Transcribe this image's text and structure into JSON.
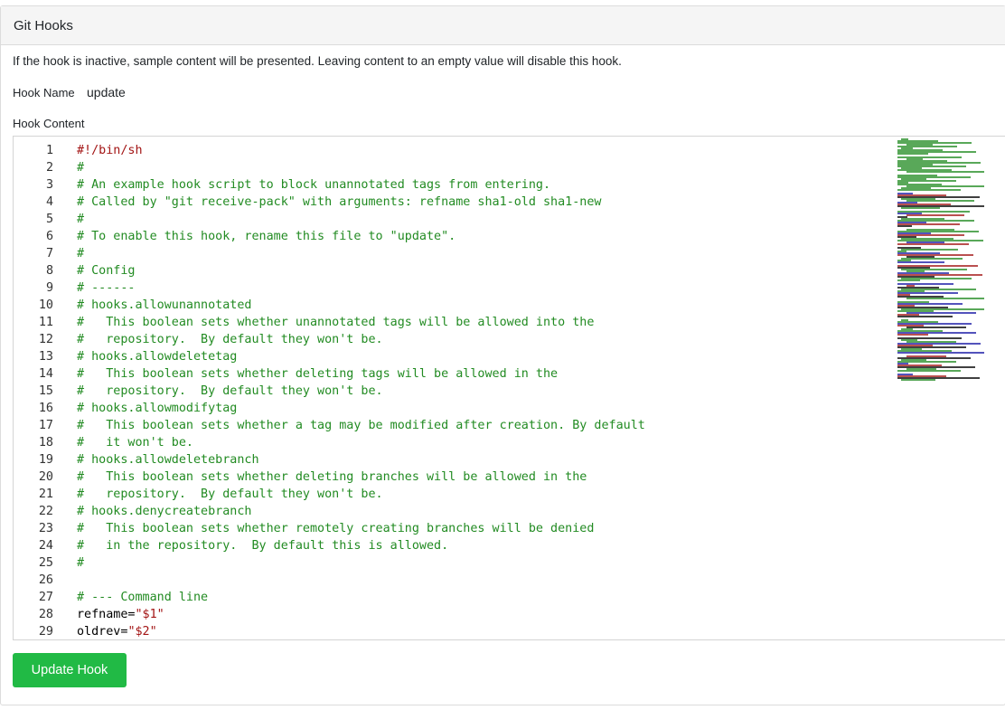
{
  "header": {
    "title": "Git Hooks"
  },
  "description": "If the hook is inactive, sample content will be presented. Leaving content to an empty value will disable this hook.",
  "hook": {
    "name_label": "Hook Name",
    "name_value": "update",
    "content_label": "Hook Content"
  },
  "editor": {
    "lines": [
      {
        "n": "1",
        "t": "#!/bin/sh",
        "k": "shebang"
      },
      {
        "n": "2",
        "t": "#",
        "k": "comment"
      },
      {
        "n": "3",
        "t": "# An example hook script to block unannotated tags from entering.",
        "k": "comment"
      },
      {
        "n": "4",
        "t": "# Called by \"git receive-pack\" with arguments: refname sha1-old sha1-new",
        "k": "comment"
      },
      {
        "n": "5",
        "t": "#",
        "k": "comment"
      },
      {
        "n": "6",
        "t": "# To enable this hook, rename this file to \"update\".",
        "k": "comment"
      },
      {
        "n": "7",
        "t": "#",
        "k": "comment"
      },
      {
        "n": "8",
        "t": "# Config",
        "k": "comment"
      },
      {
        "n": "9",
        "t": "# ------",
        "k": "comment"
      },
      {
        "n": "10",
        "t": "# hooks.allowunannotated",
        "k": "comment"
      },
      {
        "n": "11",
        "t": "#   This boolean sets whether unannotated tags will be allowed into the",
        "k": "comment"
      },
      {
        "n": "12",
        "t": "#   repository.  By default they won't be.",
        "k": "comment"
      },
      {
        "n": "13",
        "t": "# hooks.allowdeletetag",
        "k": "comment"
      },
      {
        "n": "14",
        "t": "#   This boolean sets whether deleting tags will be allowed in the",
        "k": "comment"
      },
      {
        "n": "15",
        "t": "#   repository.  By default they won't be.",
        "k": "comment"
      },
      {
        "n": "16",
        "t": "# hooks.allowmodifytag",
        "k": "comment"
      },
      {
        "n": "17",
        "t": "#   This boolean sets whether a tag may be modified after creation. By default",
        "k": "comment"
      },
      {
        "n": "18",
        "t": "#   it won't be.",
        "k": "comment"
      },
      {
        "n": "19",
        "t": "# hooks.allowdeletebranch",
        "k": "comment"
      },
      {
        "n": "20",
        "t": "#   This boolean sets whether deleting branches will be allowed in the",
        "k": "comment"
      },
      {
        "n": "21",
        "t": "#   repository.  By default they won't be.",
        "k": "comment"
      },
      {
        "n": "22",
        "t": "# hooks.denycreatebranch",
        "k": "comment"
      },
      {
        "n": "23",
        "t": "#   This boolean sets whether remotely creating branches will be denied",
        "k": "comment"
      },
      {
        "n": "24",
        "t": "#   in the repository.  By default this is allowed.",
        "k": "comment"
      },
      {
        "n": "25",
        "t": "#",
        "k": "comment"
      },
      {
        "n": "26",
        "t": "",
        "k": "plain"
      },
      {
        "n": "27",
        "t": "# --- Command line",
        "k": "comment"
      },
      {
        "n": "28",
        "t": "refname=",
        "s": "\"$1\"",
        "k": "assign"
      },
      {
        "n": "29",
        "t": "oldrev=",
        "s": "\"$2\"",
        "k": "assign"
      }
    ]
  },
  "colors": {
    "comment": "#228b22",
    "string": "#a31515",
    "button": "#21ba45"
  },
  "button": {
    "label": "Update Hook"
  }
}
